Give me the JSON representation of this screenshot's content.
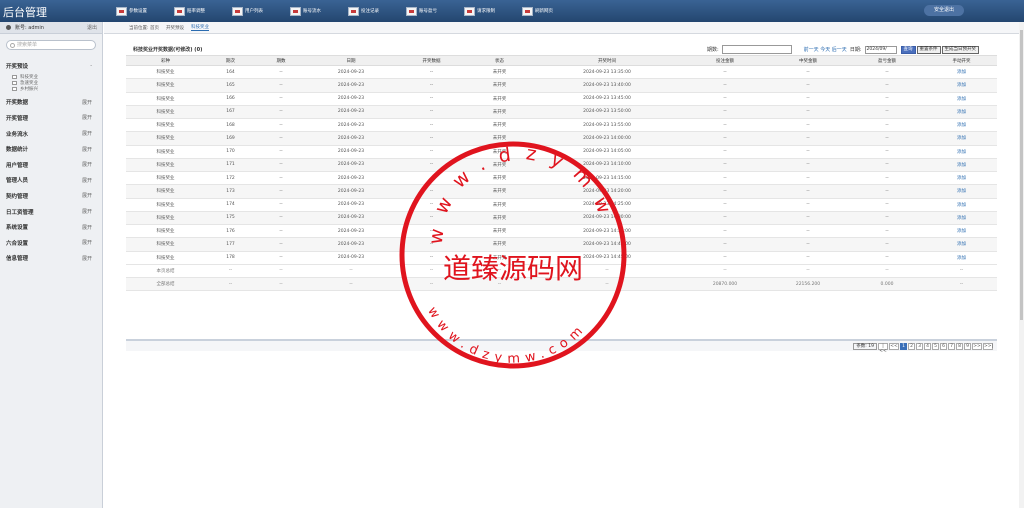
{
  "app_title": "后台管理",
  "top_nav": [
    "参数设置",
    "赔率调整",
    "用户列表",
    "账号流水",
    "投注记录",
    "账号盈亏",
    "请求限制",
    "刷新网页"
  ],
  "exit_label": "安全退出",
  "user": {
    "label": "账号: admin",
    "exit": "退出"
  },
  "search_placeholder": "搜索菜单",
  "sidebar": {
    "group_open": {
      "label": "开奖预设",
      "toggle": "-",
      "subs": [
        "科技奖业",
        "急速奖业",
        "乡村振兴"
      ]
    },
    "menus": [
      {
        "label": "开奖数据",
        "toggle": "展开"
      },
      {
        "label": "开奖管理",
        "toggle": "展开"
      },
      {
        "label": "业务流水",
        "toggle": "展开"
      },
      {
        "label": "数据统计",
        "toggle": "展开"
      },
      {
        "label": "用户管理",
        "toggle": "展开"
      },
      {
        "label": "管理人员",
        "toggle": "展开"
      },
      {
        "label": "契约管理",
        "toggle": "展开"
      },
      {
        "label": "日工资管理",
        "toggle": "展开"
      },
      {
        "label": "系统设置",
        "toggle": "展开"
      },
      {
        "label": "六合设置",
        "toggle": "展开"
      },
      {
        "label": "信息管理",
        "toggle": "展开"
      }
    ]
  },
  "breadcrumb": [
    "当前位置: 首页",
    "开奖预设",
    "科技奖业"
  ],
  "panel": {
    "title": "科技奖业开奖数据(可修改) (0)",
    "period_label": "期数:",
    "nav_links": "前一天 今天 后一天",
    "date_label": "日期:",
    "date_value": "2024/09/",
    "btn_query": "查询",
    "btn_reset": "重置条件",
    "btn_generate": "生成当日预开奖"
  },
  "table": {
    "headers": [
      "彩种",
      "期次",
      "期数",
      "日期",
      "开奖数据",
      "状态",
      "开奖时间",
      "投注金额",
      "中奖金额",
      "盈亏金额",
      "手动开奖"
    ],
    "rows": [
      [
        "科技奖业",
        "164",
        "--",
        "2024-09-23",
        "--",
        "未开奖",
        "2024-09-23 13:35:00",
        "--",
        "--",
        "--",
        "添加"
      ],
      [
        "科技奖业",
        "165",
        "--",
        "2024-09-23",
        "--",
        "未开奖",
        "2024-09-23 13:40:00",
        "--",
        "--",
        "--",
        "添加"
      ],
      [
        "科技奖业",
        "166",
        "--",
        "2024-09-23",
        "--",
        "未开奖",
        "2024-09-23 13:45:00",
        "--",
        "--",
        "--",
        "添加"
      ],
      [
        "科技奖业",
        "167",
        "--",
        "2024-09-23",
        "--",
        "未开奖",
        "2024-09-23 13:50:00",
        "--",
        "--",
        "--",
        "添加"
      ],
      [
        "科技奖业",
        "168",
        "--",
        "2024-09-23",
        "--",
        "未开奖",
        "2024-09-23 13:55:00",
        "--",
        "--",
        "--",
        "添加"
      ],
      [
        "科技奖业",
        "169",
        "--",
        "2024-09-23",
        "--",
        "未开奖",
        "2024-09-23 14:00:00",
        "--",
        "--",
        "--",
        "添加"
      ],
      [
        "科技奖业",
        "170",
        "--",
        "2024-09-23",
        "--",
        "未开奖",
        "2024-09-23 14:05:00",
        "--",
        "--",
        "--",
        "添加"
      ],
      [
        "科技奖业",
        "171",
        "--",
        "2024-09-23",
        "--",
        "未开奖",
        "2024-09-23 14:10:00",
        "--",
        "--",
        "--",
        "添加"
      ],
      [
        "科技奖业",
        "172",
        "--",
        "2024-09-23",
        "--",
        "未开奖",
        "2024-09-23 14:15:00",
        "--",
        "--",
        "--",
        "添加"
      ],
      [
        "科技奖业",
        "173",
        "--",
        "2024-09-23",
        "--",
        "未开奖",
        "2024-09-23 14:20:00",
        "--",
        "--",
        "--",
        "添加"
      ],
      [
        "科技奖业",
        "174",
        "--",
        "2024-09-23",
        "--",
        "未开奖",
        "2024-09-23 14:25:00",
        "--",
        "--",
        "--",
        "添加"
      ],
      [
        "科技奖业",
        "175",
        "--",
        "2024-09-23",
        "--",
        "未开奖",
        "2024-09-23 14:30:00",
        "--",
        "--",
        "--",
        "添加"
      ],
      [
        "科技奖业",
        "176",
        "--",
        "2024-09-23",
        "--",
        "未开奖",
        "2024-09-23 14:35:00",
        "--",
        "--",
        "--",
        "添加"
      ],
      [
        "科技奖业",
        "177",
        "--",
        "2024-09-23",
        "--",
        "未开奖",
        "2024-09-23 14:40:00",
        "--",
        "--",
        "--",
        "添加"
      ],
      [
        "科技奖业",
        "178",
        "--",
        "2024-09-23",
        "--",
        "未开奖",
        "2024-09-23 14:45:00",
        "--",
        "--",
        "--",
        "添加"
      ]
    ],
    "summary": [
      [
        "本页总结",
        "--",
        "--",
        "--",
        "--",
        "--",
        "--",
        "--",
        "--",
        "--",
        "--"
      ],
      [
        "全部总结",
        "--",
        "--",
        "--",
        "--",
        "--",
        "--",
        "20870.000",
        "22156.200",
        "0.000",
        "--"
      ]
    ]
  },
  "pager": {
    "count_label": "条数: 19",
    "first": "|<<",
    "prev": "<<",
    "pages": [
      "1",
      "2",
      "3",
      "4",
      "5",
      "6",
      "7",
      "8",
      "9"
    ],
    "next": ">>",
    "last": ">>|"
  },
  "watermark": {
    "url_top": "www.dzymw.com",
    "name": "道臻源码网",
    "url_bottom": "www.dzymw.com"
  },
  "colors": {
    "header_bg": "#24466f",
    "accent": "#2a6bb0",
    "stamp": "#e0141e"
  }
}
